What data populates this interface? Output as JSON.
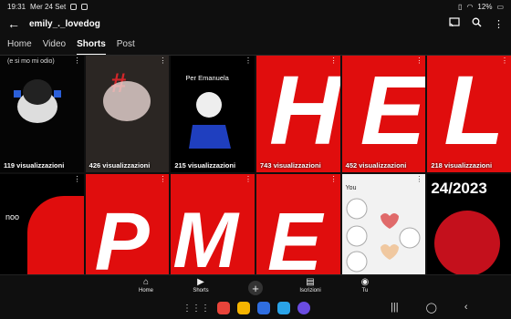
{
  "status": {
    "time": "19:31",
    "date": "Mer 24 Set",
    "battery": "12%"
  },
  "header": {
    "back_icon": "arrow-back-icon",
    "channel_name": "emily_._lovedog",
    "actions": [
      "cast-icon",
      "search-icon",
      "more-vert-icon"
    ]
  },
  "tabs": [
    {
      "label": "Home",
      "active": false
    },
    {
      "label": "Video",
      "active": false
    },
    {
      "label": "Shorts",
      "active": true
    },
    {
      "label": "Post",
      "active": false
    }
  ],
  "shorts": [
    {
      "views": "119 visualizzazioni",
      "caption": "(e si mo mi odio)"
    },
    {
      "views": "426 visualizzazioni",
      "caption": "#"
    },
    {
      "views": "215 visualizzazioni",
      "caption": "Per Emanuela"
    },
    {
      "views": "743 visualizzazioni",
      "caption": "H"
    },
    {
      "views": "452 visualizzazioni",
      "caption": "E"
    },
    {
      "views": "218 visualizzazioni",
      "caption": "L"
    },
    {
      "views": "",
      "caption": "noo"
    },
    {
      "views": "",
      "caption": "P"
    },
    {
      "views": "",
      "caption": "M"
    },
    {
      "views": "",
      "caption": "E"
    },
    {
      "views": "",
      "caption": "You"
    },
    {
      "views": "",
      "caption": "24/2023"
    }
  ],
  "bottom_nav": [
    {
      "label": "Home",
      "icon": "home-icon"
    },
    {
      "label": "Shorts",
      "icon": "shorts-icon"
    },
    {
      "label": "",
      "icon": "add-icon"
    },
    {
      "label": "Iscrizioni",
      "icon": "subscriptions-icon"
    },
    {
      "label": "Tu",
      "icon": "you-icon"
    }
  ],
  "colors": {
    "background": "#0f0f0f",
    "shorts_red": "#e00d0d",
    "text": "#ffffff"
  }
}
